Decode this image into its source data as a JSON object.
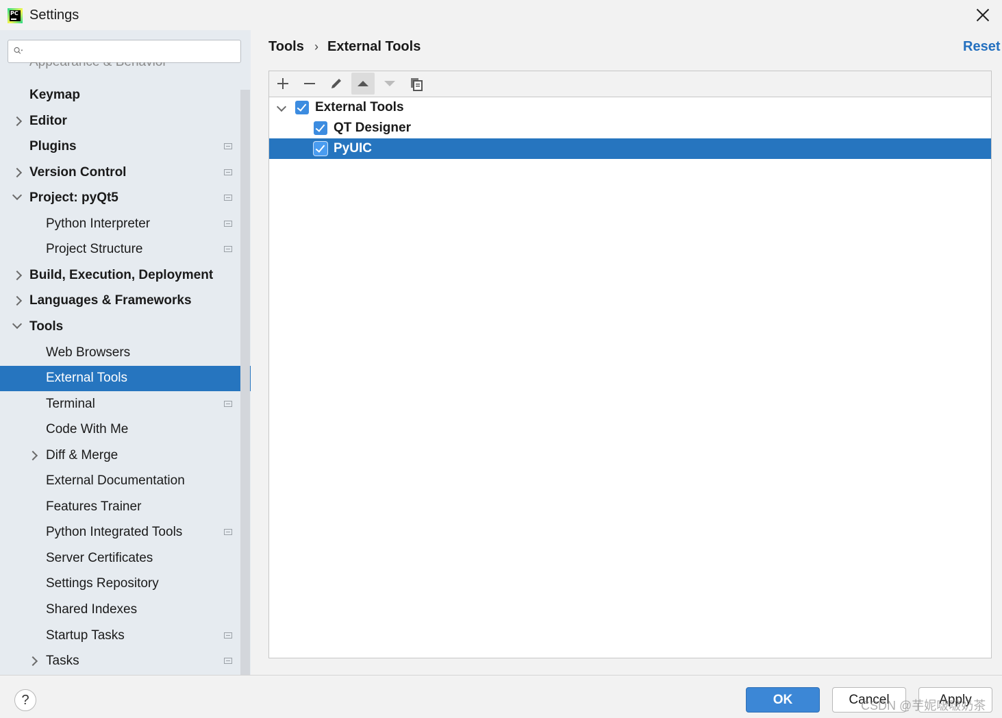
{
  "window": {
    "title": "Settings"
  },
  "sidebar": {
    "search": {
      "value": "",
      "placeholder": ""
    },
    "clipped_item": "Appearance & Behavior",
    "items": [
      {
        "label": "Keymap",
        "bold": true,
        "chevron": "none",
        "project_icon": false,
        "selected": false
      },
      {
        "label": "Editor",
        "bold": true,
        "chevron": "right",
        "project_icon": false,
        "selected": false
      },
      {
        "label": "Plugins",
        "bold": true,
        "chevron": "none",
        "project_icon": true,
        "selected": false
      },
      {
        "label": "Version Control",
        "bold": true,
        "chevron": "right",
        "project_icon": true,
        "selected": false
      },
      {
        "label": "Project: pyQt5",
        "bold": true,
        "chevron": "down",
        "project_icon": true,
        "selected": false
      },
      {
        "label": "Python Interpreter",
        "bold": false,
        "chevron": "none",
        "project_icon": true,
        "selected": false
      },
      {
        "label": "Project Structure",
        "bold": false,
        "chevron": "none",
        "project_icon": true,
        "selected": false
      },
      {
        "label": "Build, Execution, Deployment",
        "bold": true,
        "chevron": "right",
        "project_icon": false,
        "selected": false
      },
      {
        "label": "Languages & Frameworks",
        "bold": true,
        "chevron": "right",
        "project_icon": false,
        "selected": false
      },
      {
        "label": "Tools",
        "bold": true,
        "chevron": "down",
        "project_icon": false,
        "selected": false
      },
      {
        "label": "Web Browsers",
        "bold": false,
        "chevron": "none",
        "project_icon": false,
        "selected": false
      },
      {
        "label": "External Tools",
        "bold": false,
        "chevron": "none",
        "project_icon": false,
        "selected": true
      },
      {
        "label": "Terminal",
        "bold": false,
        "chevron": "none",
        "project_icon": true,
        "selected": false
      },
      {
        "label": "Code With Me",
        "bold": false,
        "chevron": "none",
        "project_icon": false,
        "selected": false
      },
      {
        "label": "Diff & Merge",
        "bold": false,
        "chevron": "right",
        "project_icon": false,
        "selected": false
      },
      {
        "label": "External Documentation",
        "bold": false,
        "chevron": "none",
        "project_icon": false,
        "selected": false
      },
      {
        "label": "Features Trainer",
        "bold": false,
        "chevron": "none",
        "project_icon": false,
        "selected": false
      },
      {
        "label": "Python Integrated Tools",
        "bold": false,
        "chevron": "none",
        "project_icon": true,
        "selected": false
      },
      {
        "label": "Server Certificates",
        "bold": false,
        "chevron": "none",
        "project_icon": false,
        "selected": false
      },
      {
        "label": "Settings Repository",
        "bold": false,
        "chevron": "none",
        "project_icon": false,
        "selected": false
      },
      {
        "label": "Shared Indexes",
        "bold": false,
        "chevron": "none",
        "project_icon": false,
        "selected": false
      },
      {
        "label": "Startup Tasks",
        "bold": false,
        "chevron": "none",
        "project_icon": true,
        "selected": false
      },
      {
        "label": "Tasks",
        "bold": false,
        "chevron": "right",
        "project_icon": true,
        "selected": false
      }
    ]
  },
  "header": {
    "breadcrumb": [
      "Tools",
      "External Tools"
    ],
    "separator": "›",
    "reset_label": "Reset"
  },
  "toolbar": {
    "buttons": [
      {
        "icon": "plus-icon",
        "enabled": true
      },
      {
        "icon": "minus-icon",
        "enabled": true
      },
      {
        "icon": "pencil-icon",
        "enabled": true
      },
      {
        "icon": "arrow-up-icon",
        "enabled": true
      },
      {
        "icon": "arrow-down-icon",
        "enabled": false
      },
      {
        "icon": "copy-icon",
        "enabled": true
      }
    ]
  },
  "tools_tree": [
    {
      "label": "External Tools",
      "checked": true,
      "expanded": true,
      "level": 0,
      "selected": false
    },
    {
      "label": "QT Designer",
      "checked": true,
      "level": 1,
      "selected": false
    },
    {
      "label": "PyUIC",
      "checked": true,
      "level": 1,
      "selected": true
    }
  ],
  "footer": {
    "help_label": "?",
    "ok_label": "OK",
    "cancel_label": "Cancel",
    "apply_label": "Apply",
    "watermark": "CSDN @芋妮啵啵奶茶"
  },
  "colors": {
    "selection": "#2675bf",
    "accent_link": "#2470bf",
    "checkbox": "#3c8ce0",
    "sidebar_bg": "#e6ebf0"
  }
}
